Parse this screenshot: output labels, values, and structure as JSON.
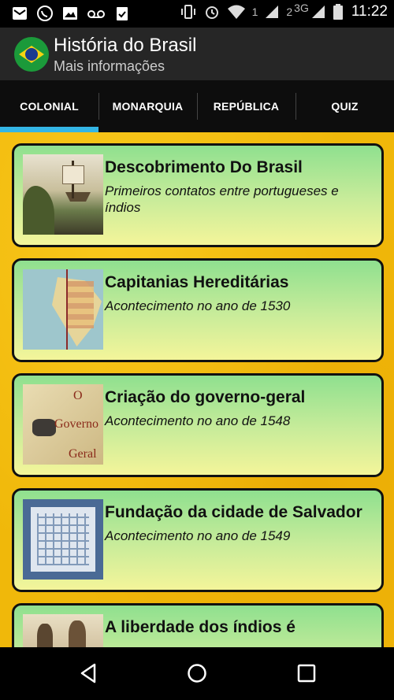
{
  "status_bar": {
    "sim1_label": "1",
    "sim2_label": "2",
    "network": "3G",
    "time": "11:22",
    "icons": [
      "mail-icon",
      "whatsapp-icon",
      "image-icon",
      "voicemail-icon",
      "clipboard-check-icon",
      "vibrate-icon",
      "alarm-icon",
      "wifi-icon",
      "signal-icon",
      "signal-icon",
      "battery-icon"
    ]
  },
  "app_bar": {
    "title": "História do Brasil",
    "subtitle": "Mais informações"
  },
  "tabs": [
    {
      "label": "COLONIAL",
      "active": true
    },
    {
      "label": "MONARQUIA",
      "active": false
    },
    {
      "label": "REPÚBLICA",
      "active": false
    },
    {
      "label": "QUIZ",
      "active": false
    }
  ],
  "cards": [
    {
      "title": "Descobrimento Do Brasil",
      "subtitle": "Primeiros contatos entre portugueses e índios"
    },
    {
      "title": "Capitanias Hereditárias",
      "subtitle": "Acontecimento no ano de 1530"
    },
    {
      "title": "Criação do governo-geral",
      "subtitle": "Acontecimento no ano de 1548"
    },
    {
      "title": "Fundação da cidade de Salvador",
      "subtitle": "Acontecimento no ano de 1549"
    },
    {
      "title": "A liberdade dos índios é",
      "subtitle": ""
    }
  ],
  "thumb_text": {
    "governo_o": "O",
    "governo_word": "Governo",
    "governo_geral": "Geral"
  },
  "colors": {
    "tab_indicator": "#33b5e5",
    "background": "#f0b80a",
    "card_top": "#8fe08f",
    "card_bottom": "#f4f59a"
  }
}
